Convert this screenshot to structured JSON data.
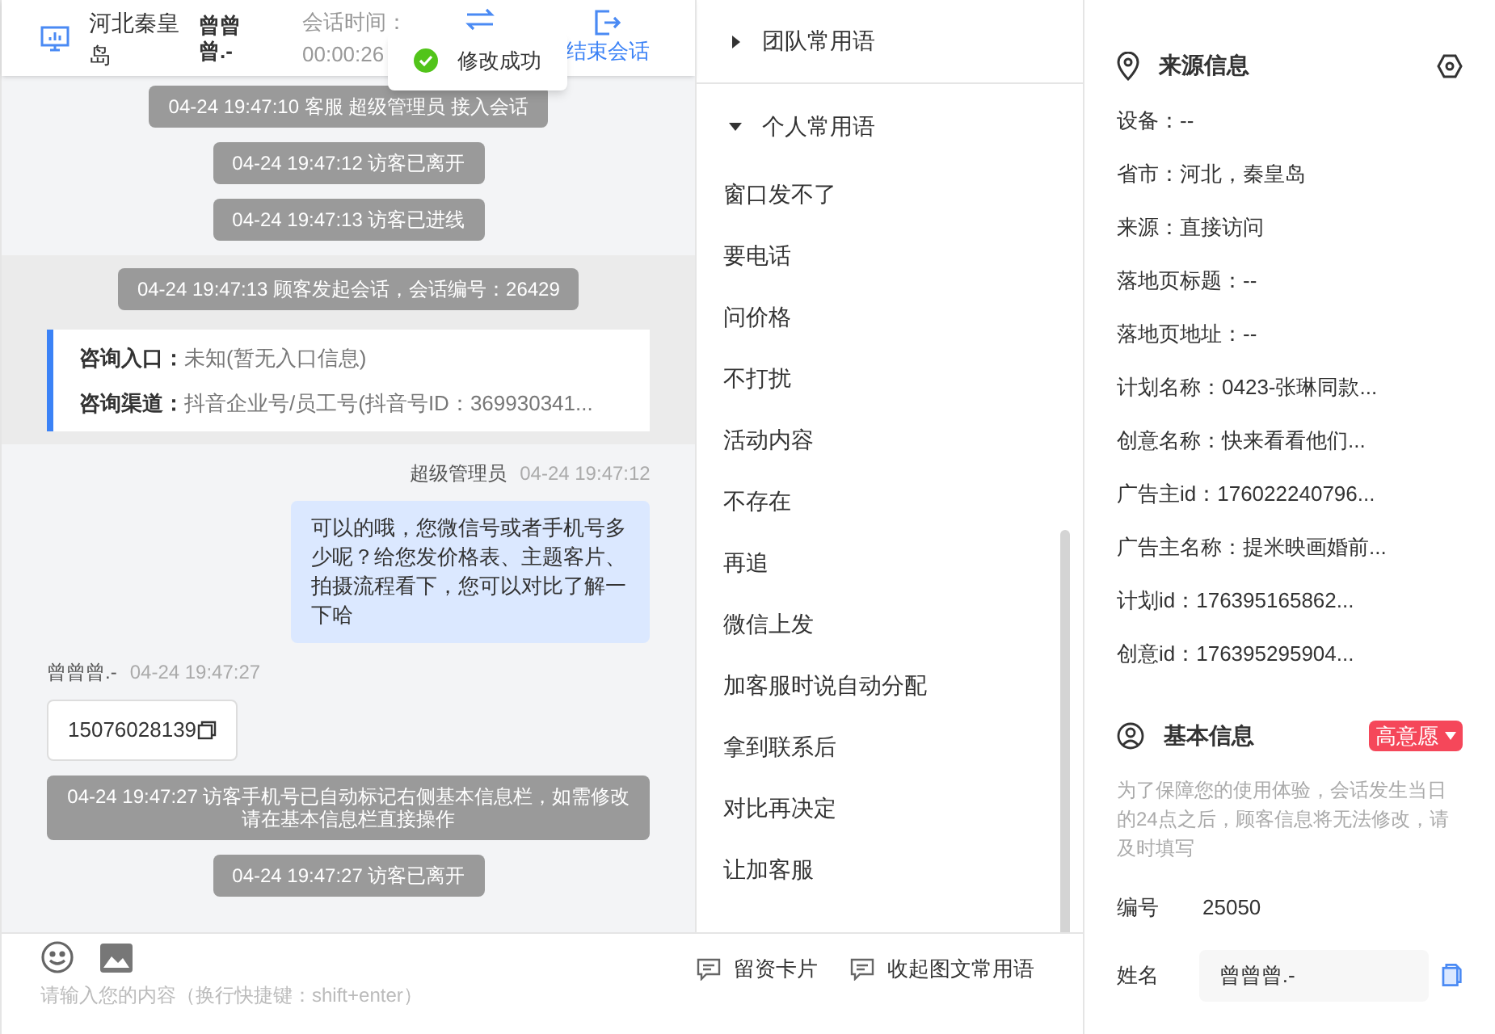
{
  "header": {
    "location": "河北秦皇岛",
    "visitor": "曾曾曾.-",
    "time_label": "会话时间：",
    "time": "00:00:26",
    "end_label": "结束会话"
  },
  "toast": {
    "text": "修改成功"
  },
  "chat": [
    {
      "kind": "system",
      "text": "04-24 19:47:10 客服 超级管理员 接入会话"
    },
    {
      "kind": "system",
      "text": "04-24 19:47:12 访客已离开"
    },
    {
      "kind": "system",
      "text": "04-24 19:47:13 访客已进线"
    },
    {
      "kind": "session",
      "text": "04-24 19:47:13 顾客发起会话，会话编号：26429",
      "fields": [
        {
          "label": "咨询入口：",
          "value": "未知(暂无入口信息)"
        },
        {
          "label": "咨询渠道：",
          "value": "抖音企业号/员工号(抖音号ID：369930341..."
        }
      ]
    },
    {
      "kind": "agent",
      "sender": "超级管理员",
      "time": "04-24 19:47:12",
      "text": "可以的哦，您微信号或者手机号多少呢？给您发价格表、主题客片、拍摄流程看下，您可以对比了解一下哈"
    },
    {
      "kind": "visitor",
      "sender": "曾曾曾.-",
      "time": "04-24 19:47:27",
      "text": "15076028139"
    },
    {
      "kind": "system",
      "text": "04-24 19:47:27 访客手机号已自动标记右侧基本信息栏，如需修改请在基本信息栏直接操作"
    },
    {
      "kind": "system",
      "text": "04-24 19:47:27 访客已离开"
    }
  ],
  "composer": {
    "placeholder": "请输入您的内容（换行快捷键：shift+enter）"
  },
  "phrases": {
    "groups": [
      {
        "title": "团队常用语",
        "expanded": false
      },
      {
        "title": "个人常用语",
        "expanded": true
      }
    ],
    "items": [
      "窗口发不了",
      "要电话",
      "问价格",
      "不打扰",
      "活动内容",
      "不存在",
      "再追",
      "微信上发",
      "加客服时说自动分配",
      "拿到联系后",
      "对比再决定",
      "让加客服"
    ],
    "actions": [
      "留资卡片",
      "收起图文常用语"
    ]
  },
  "source": {
    "title": "来源信息",
    "rows": [
      "设备：--",
      "省市：河北，秦皇岛",
      "来源：直接访问",
      "落地页标题：--",
      "落地页地址：--",
      "计划名称：0423-张琳同款...",
      "创意名称：快来看看他们...",
      "广告主id：176022240796...",
      "广告主名称：提米映画婚前...",
      "计划id：176395165862...",
      "创意id：176395295904..."
    ]
  },
  "basic": {
    "title": "基本信息",
    "tag": "高意愿",
    "note": "为了保障您的使用体验，会话发生当日的24点之后，顾客信息将无法修改，请及时填写",
    "id_label": "编号",
    "id": "25050",
    "name_label": "姓名",
    "name": "曾曾曾.-"
  }
}
